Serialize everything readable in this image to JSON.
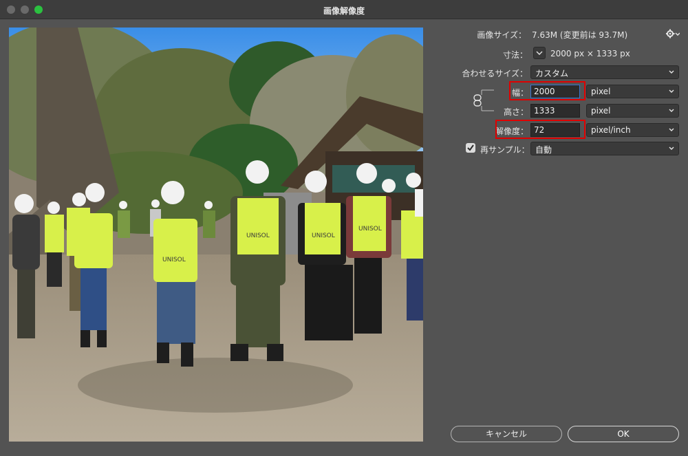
{
  "window": {
    "title": "画像解像度"
  },
  "info": {
    "image_size_label": "画像サイズ：",
    "image_size_value": "7.63M (変更前は 93.7M)",
    "dimensions_label": "寸法：",
    "dimensions_value": "2000 px × 1333 px"
  },
  "fit_to": {
    "label": "合わせるサイズ：",
    "value": "カスタム"
  },
  "width": {
    "label": "幅：",
    "value": "2000",
    "unit": "pixel"
  },
  "height": {
    "label": "高さ：",
    "value": "1333",
    "unit": "pixel"
  },
  "resolution": {
    "label": "解像度：",
    "value": "72",
    "unit": "pixel/inch"
  },
  "resample": {
    "label": "再サンプル：",
    "value": "自動",
    "checked": true
  },
  "buttons": {
    "cancel": "キャンセル",
    "ok": "OK"
  },
  "preview": {
    "vest_text": "UNISOL"
  },
  "colors": {
    "highlight": "#e00000",
    "focus": "#3a74d0",
    "vest": "#d8f04a"
  },
  "icons": {
    "gear": "gear-icon",
    "link": "link-chain-icon",
    "chevron": "chevron-down-icon",
    "check": "checkmark-icon"
  }
}
